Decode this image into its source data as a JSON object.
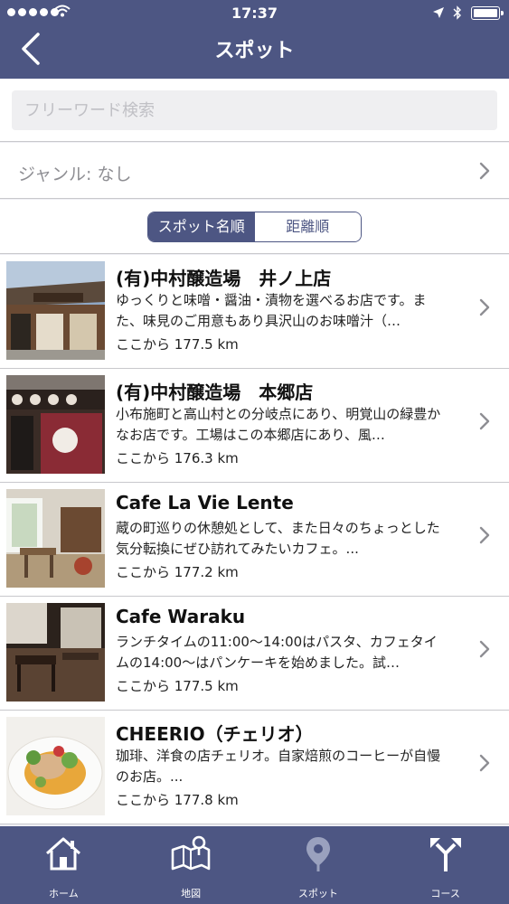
{
  "status_bar": {
    "time": "17:37"
  },
  "nav": {
    "title": "スポット"
  },
  "search": {
    "placeholder": "フリーワード検索"
  },
  "genre": {
    "label": "ジャンル: なし"
  },
  "sort": {
    "options": [
      "スポット名順",
      "距離順"
    ],
    "selected": "スポット名順"
  },
  "spots": [
    {
      "title": "(有)中村醸造場　井ノ上店",
      "description": "ゆっくりと味噌・醤油・漬物を選べるお店です。また、味見のご用意もあり具沢山のお味噌汁（…",
      "distance": "ここから 177.5 km"
    },
    {
      "title": "(有)中村醸造場　本郷店",
      "description": "小布施町と高山村との分岐点にあり、明覚山の緑豊かなお店です。工場はこの本郷店にあり、風…",
      "distance": "ここから 176.3 km"
    },
    {
      "title": "Cafe La Vie Lente",
      "description": "蔵の町巡りの休憩処として、また日々のちょっとした気分転換にぜひ訪れてみたいカフェ。...",
      "distance": "ここから 177.2 km"
    },
    {
      "title": "Cafe Waraku",
      "description": "ランチタイムの11:00〜14:00はパスタ、カフェタイムの14:00〜はパンケーキを始めました。試…",
      "distance": "ここから 177.5 km"
    },
    {
      "title": "CHEERIO（チェリオ）",
      "description": "珈琲、洋食の店チェリオ。自家焙煎のコーヒーが自慢のお店。...",
      "distance": "ここから 177.8 km"
    }
  ],
  "tabbar": {
    "tabs": [
      "ホーム",
      "地図",
      "スポット",
      "コース"
    ],
    "selected": "スポット"
  },
  "colors": {
    "primary": "#4d5683",
    "background": "#efeff4"
  }
}
